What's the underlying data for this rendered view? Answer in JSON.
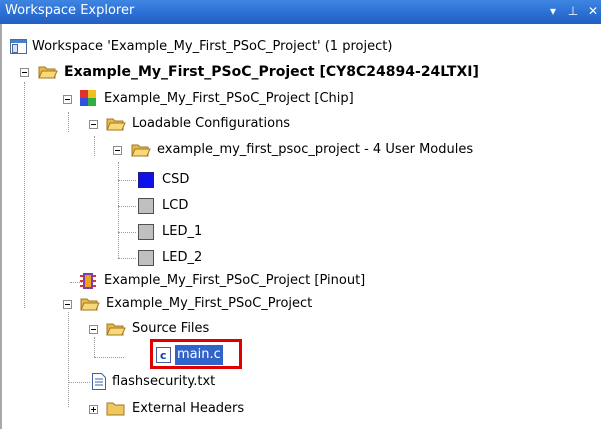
{
  "window": {
    "title": "Workspace Explorer",
    "dropdown_glyph": "▾",
    "pin_glyph": "⊥",
    "close_glyph": "✕"
  },
  "tree": {
    "workspace": "Workspace 'Example_My_First_PSoC_Project' (1 project)",
    "project": "Example_My_First_PSoC_Project [CY8C24894-24LTXI]",
    "chip": "Example_My_First_PSoC_Project [Chip]",
    "loadable": "Loadable Configurations",
    "config": "example_my_first_psoc_project - 4 User Modules",
    "modules": [
      "CSD",
      "LCD",
      "LED_1",
      "LED_2"
    ],
    "pinout": "Example_My_First_PSoC_Project [Pinout]",
    "project_folder": "Example_My_First_PSoC_Project",
    "source_files": "Source Files",
    "main_file": "main.c",
    "flash_file": "flashsecurity.txt",
    "external_headers": "External Headers"
  },
  "colors": {
    "module_active": "#1010e8",
    "module_inactive": "#c0c0c0",
    "selection": "#3164c8",
    "highlight_box": "#e00000"
  }
}
